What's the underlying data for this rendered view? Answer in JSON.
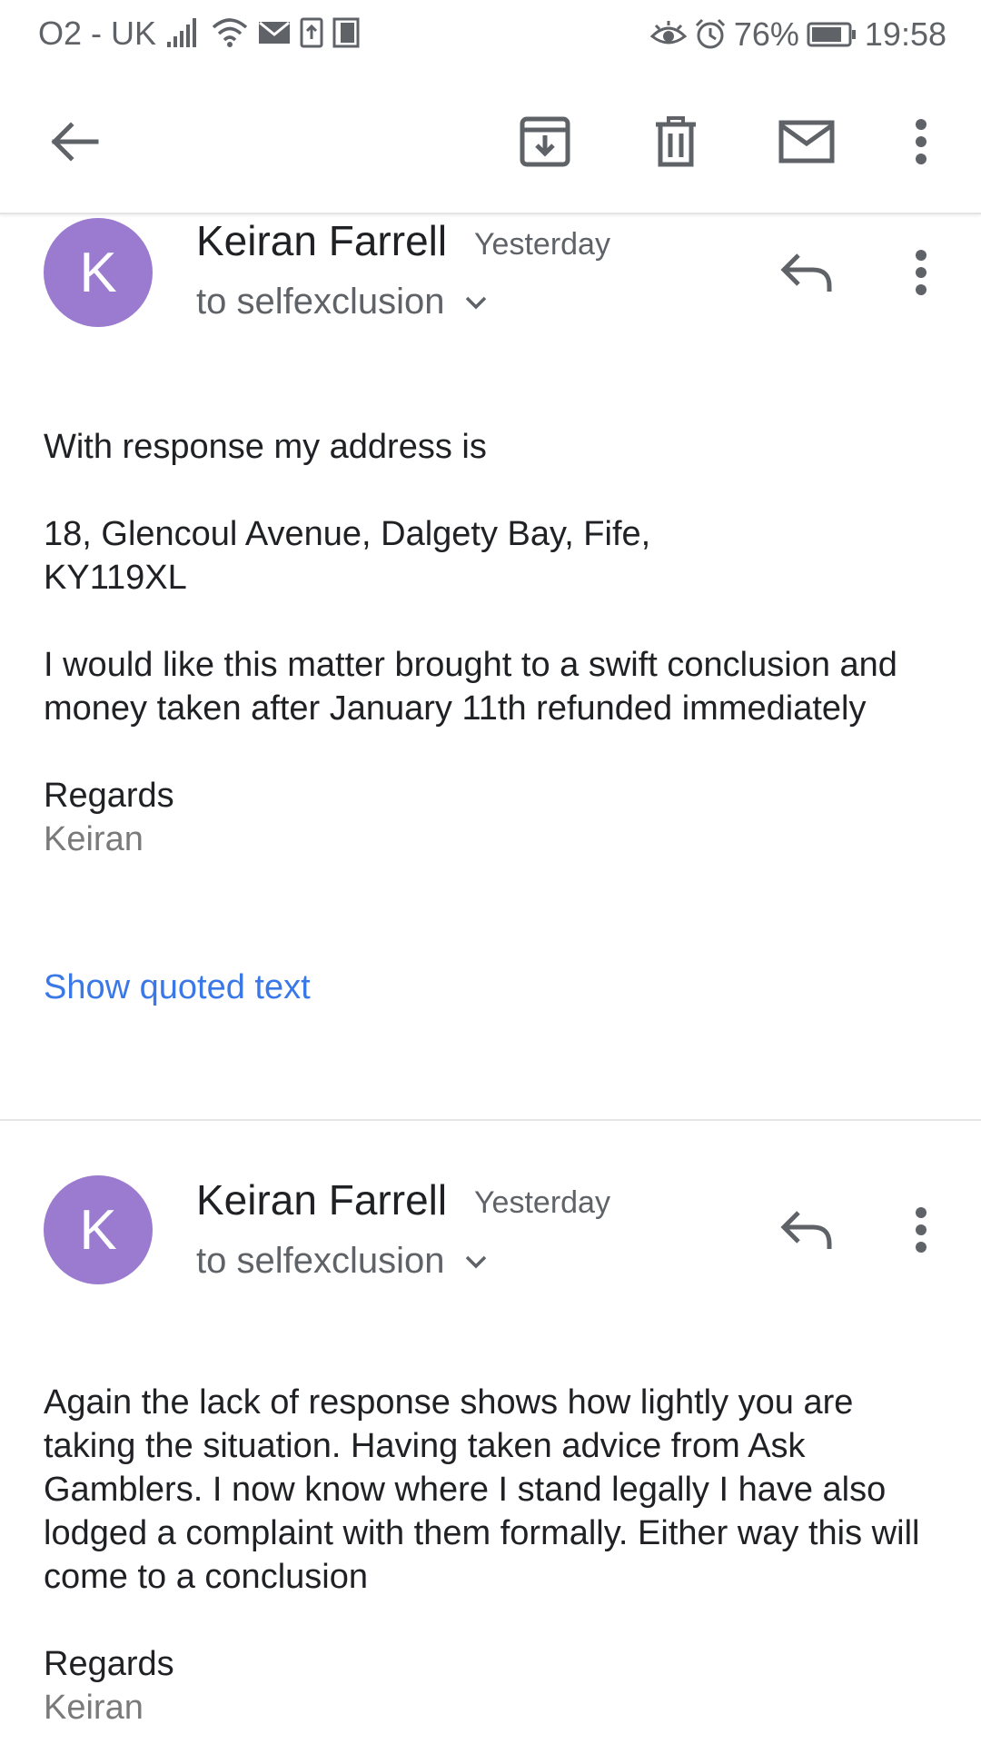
{
  "status_bar": {
    "carrier": "O2 - UK",
    "battery": "76%",
    "time": "19:58",
    "icons_left": [
      "signal-icon",
      "wifi-icon",
      "mail-notification-icon",
      "upload-icon",
      "sim-icon"
    ],
    "icons_right": [
      "eye-icon",
      "alarm-icon",
      "battery-icon"
    ]
  },
  "toolbar": {
    "actions": [
      "back-icon",
      "archive-icon",
      "delete-icon",
      "mark-unread-icon",
      "more-vert-icon"
    ]
  },
  "messages": [
    {
      "avatar_letter": "K",
      "sender": "Keiran Farrell",
      "date": "Yesterday",
      "recipient": "to selfexclusion",
      "body": {
        "line1": "With response my address is",
        "address1": "18, Glencoul Avenue, Dalgety Bay, Fife,",
        "address2": "KY119XL",
        "paragraph": "I would like this matter brought to a swift conclusion and money taken after January 11th refunded immediately",
        "regards": "Regards",
        "signature": "Keiran"
      },
      "show_quoted": "Show quoted text"
    },
    {
      "avatar_letter": "K",
      "sender": "Keiran Farrell",
      "date": "Yesterday",
      "recipient": "to selfexclusion",
      "body": {
        "paragraph": "Again the lack of response shows how lightly you are taking the situation. Having taken advice from Ask Gamblers. I now know where I stand legally I have also lodged a complaint with them formally. Either way this will come to a conclusion",
        "regards": "Regards",
        "signature": "Keiran"
      }
    }
  ],
  "colors": {
    "avatar": "#9a7bd0",
    "link": "#3b78e7",
    "secondary_text": "#5f6368",
    "icon": "#5f6368"
  }
}
